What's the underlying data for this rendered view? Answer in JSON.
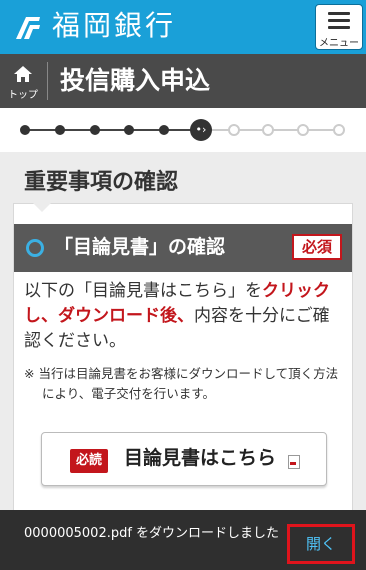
{
  "header": {
    "bank_name": "福岡銀行",
    "menu_label": "メニュー",
    "logo_icon": "fukuoka-bank-logo",
    "menu_icon": "hamburger-icon",
    "brand_color": "#1aa0d8"
  },
  "title_bar": {
    "home_label": "トップ",
    "home_icon": "home-icon",
    "title": "投信購入申込"
  },
  "progress": {
    "total_steps": 10,
    "current_step": 6,
    "current_glyph": "•›"
  },
  "section": {
    "heading": "重要事項の確認"
  },
  "card": {
    "title": "「目論見書」の確認",
    "required_badge": "必須",
    "instruction_part1": "以下の「目論見書はこちら」を",
    "instruction_em": "クリックし、ダウンロード後、",
    "instruction_part2": "内容を十分にご確認ください。",
    "note": "※ 当行は目論見書をお客様にダウンロードして頂く方法により、電子交付を行います。",
    "download_button": {
      "badge": "必読",
      "label": "目論見書はこちら",
      "icon": "pdf-file-icon"
    },
    "accent_color": "#c3161c"
  },
  "toast": {
    "message": "0000005002.pdf をダウンロードしました",
    "open_label": "開く"
  }
}
